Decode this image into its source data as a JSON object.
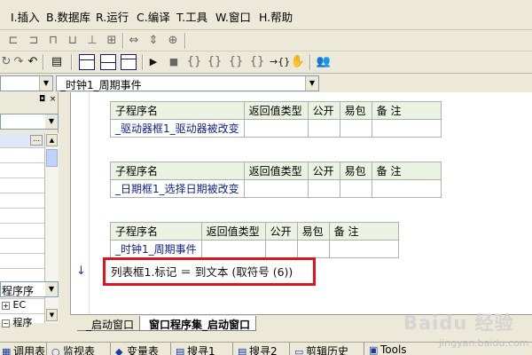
{
  "menu": {
    "items": [
      "I.插入",
      "B.数据库",
      "R.运行",
      "C.编译",
      "T.工具",
      "W.窗口",
      "H.帮助"
    ]
  },
  "toolbar": {
    "row1_icons": [
      "align-left-icon",
      "align-center-icon",
      "align-top-icon",
      "align-middle-icon",
      "align-bottom-icon",
      "same-width-icon",
      "same-height-icon",
      "same-size-icon",
      "h-space-icon",
      "v-space-icon",
      "center-icon"
    ],
    "row2_icons": [
      "redo-icon",
      "refresh-icon",
      "undo-icon",
      "preview-icon",
      "frame-icon",
      "frame-split-icon",
      "frame-tri-icon",
      "run-icon",
      "stop-icon",
      "step-into-icon",
      "step-over-icon",
      "step-out-icon",
      "run-to-cursor-icon",
      "braces-icon",
      "hand-icon",
      "debug-people-icon"
    ]
  },
  "combo": {
    "event": "_时钟1_周期事件"
  },
  "left_panel": {
    "select": "程序序",
    "tree": [
      {
        "label": "EC",
        "expanded": false
      },
      {
        "label": "程序",
        "expanded": true
      }
    ]
  },
  "editor": {
    "headers": [
      "子程序名",
      "返回值类型",
      "公开",
      "易包",
      "备 注"
    ],
    "tables": [
      {
        "name": "_驱动器框1_驱动器被改变"
      },
      {
        "name": "_日期框1_选择日期被改变"
      },
      {
        "name": "_时钟1_周期事件"
      }
    ],
    "code_line": "列表框1.标记 ＝ 到文本 (取符号 (6))",
    "highlight_color": "#e0141a"
  },
  "tabs": [
    {
      "label": "_启动窗口",
      "active": false
    },
    {
      "label": "窗口程序集_启动窗口",
      "active": true
    }
  ],
  "bottom": {
    "items": [
      "调用表",
      "监视表",
      "变量表",
      "搜寻1",
      "搜寻2",
      "剪辑历史",
      "Tools"
    ]
  },
  "watermark": {
    "text": "Baidu 经验",
    "sub": "jingyan.baidu.com"
  }
}
